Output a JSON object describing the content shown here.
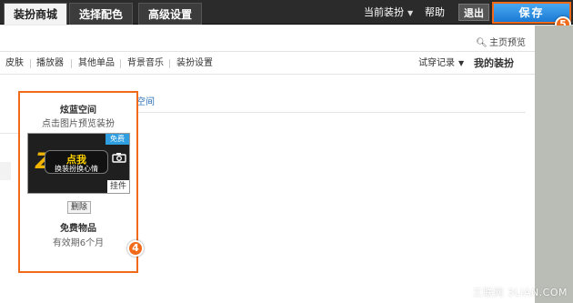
{
  "tabs": [
    {
      "label": "装扮商城",
      "active": true
    },
    {
      "label": "选择配色",
      "active": false
    },
    {
      "label": "高级设置",
      "active": false
    }
  ],
  "topbar": {
    "current_dress": "当前装扮",
    "help": "帮助",
    "exit": "退出",
    "save": "保存"
  },
  "callouts": {
    "save": "5",
    "card": "4"
  },
  "preview_link": "主页预览",
  "nav": {
    "items": [
      "皮肤",
      "播放器",
      "其他单品",
      "背景音乐",
      "装扮设置"
    ],
    "trial_record": "试穿记录",
    "my_dress": "我的装扮"
  },
  "space_link": "空间",
  "card": {
    "title": "炫蓝空间",
    "subtitle": "点击图片预览装扮",
    "free_badge": "免费",
    "thumb_big": "点我",
    "thumb_small": "换装扮换心情",
    "pendant": "挂件",
    "delete": "删除",
    "free_item": "免费物品",
    "validity": "有效期6个月"
  },
  "watermark": "三联网 3LIAN.COM",
  "colors": {
    "accent_orange": "#f06a1a",
    "save_blue": "#1a7ad4",
    "topbar": "#2b2b2b",
    "badge_blue": "#2e9ee0"
  },
  "icons": [
    "search-icon",
    "caret-down-icon",
    "camera-icon",
    "z-logo-icon"
  ]
}
